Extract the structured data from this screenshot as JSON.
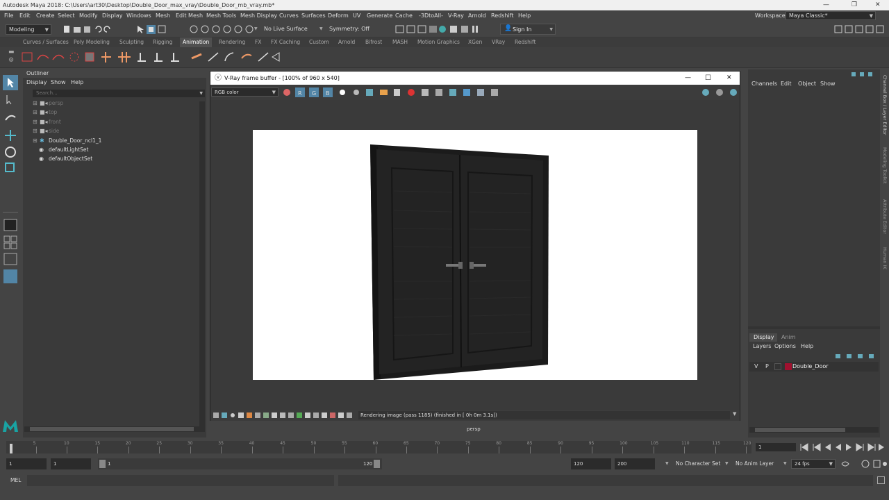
{
  "window": {
    "title": "Autodesk Maya 2018: C:\\Users\\art30\\Desktop\\Double_Door_max_vray\\Double_Door_mb_vray.mb*",
    "controls": {
      "minimize": "—",
      "maximize": "❐",
      "close": "✕"
    }
  },
  "menubar": {
    "items": [
      "File",
      "Edit",
      "Create",
      "Select",
      "Modify",
      "Display",
      "Windows",
      "Mesh",
      "Edit Mesh",
      "Mesh Tools",
      "Mesh Display",
      "Curves",
      "Surfaces",
      "Deform",
      "UV",
      "Generate",
      "Cache",
      "-3DtoAll-",
      "V-Ray",
      "Arnold",
      "Redshift",
      "Help"
    ],
    "workspace_label": "Workspace :",
    "workspace_value": "Maya Classic*"
  },
  "statusline": {
    "mode": "Modeling",
    "live_surface": "No Live Surface",
    "symmetry": "Symmetry: Off",
    "sign_in": "Sign In"
  },
  "shelf": {
    "tabs": [
      "Curves / Surfaces",
      "Poly Modeling",
      "Sculpting",
      "Rigging",
      "Animation",
      "Rendering",
      "FX",
      "FX Caching",
      "Custom",
      "Arnold",
      "Bifrost",
      "MASH",
      "Motion Graphics",
      "XGen",
      "VRay",
      "Redshift"
    ],
    "active_tab": "Animation"
  },
  "outliner": {
    "title": "Outliner",
    "menu": [
      "Display",
      "Show",
      "Help"
    ],
    "search_placeholder": "Search...",
    "items": [
      {
        "label": "persp",
        "type": "camera",
        "dim": true
      },
      {
        "label": "top",
        "type": "camera",
        "dim": true
      },
      {
        "label": "front",
        "type": "camera",
        "dim": true
      },
      {
        "label": "side",
        "type": "camera",
        "dim": true
      },
      {
        "label": "Double_Door_ncl1_1",
        "type": "mesh",
        "dim": false
      },
      {
        "label": "defaultLightSet",
        "type": "set",
        "dim": false
      },
      {
        "label": "defaultObjectSet",
        "type": "set",
        "dim": false
      }
    ]
  },
  "vfb": {
    "title": "V-Ray frame buffer - [100% of 960 x 540]",
    "channel": "RGB color",
    "status": "Rendering image (pass 1185) (finished in [ 0h  0m  3.1s])",
    "controls": {
      "minimize": "—",
      "maximize": "☐",
      "close": "✕"
    }
  },
  "viewport": {
    "camera_label": "persp"
  },
  "channelbox": {
    "menu": [
      "Channels",
      "Edit",
      "Object",
      "Show"
    ],
    "layer_tabs": [
      "Display",
      "Anim"
    ],
    "layer_menu": [
      "Layers",
      "Options",
      "Help"
    ],
    "layer": {
      "visible": "V",
      "playback": "P",
      "name": "Double_Door",
      "color": "#a0112f"
    }
  },
  "sidetabs": [
    "Channel Box / Layer Editor",
    "Modeling Toolkit",
    "Attribute Editor",
    "Human IK"
  ],
  "timeslider": {
    "ticks": [
      "1",
      "5",
      "10",
      "15",
      "20",
      "25",
      "30",
      "35",
      "40",
      "45",
      "50",
      "55",
      "60",
      "65",
      "70",
      "75",
      "80",
      "85",
      "90",
      "95",
      "100",
      "105",
      "110",
      "115",
      "120"
    ],
    "current_frame": "1"
  },
  "rangeslider": {
    "start": "1",
    "inner_start": "1",
    "bar_start": "1",
    "bar_end": "120",
    "end": "120",
    "outer_end": "200",
    "character_set": "No Character Set",
    "anim_layer": "No Anim Layer",
    "fps": "24 fps"
  },
  "cmdline": {
    "label": "MEL"
  },
  "colors": {
    "accent": "#5285a6",
    "background": "#444444",
    "panel": "#3a3a3a",
    "maya_logo": "#19a3a3"
  }
}
